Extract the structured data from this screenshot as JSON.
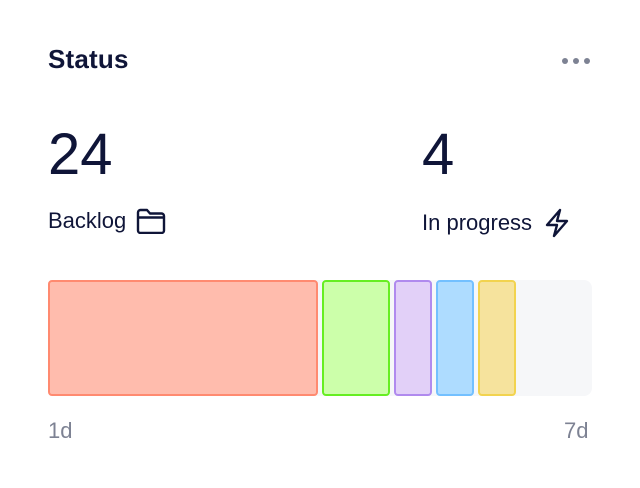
{
  "header": {
    "title": "Status",
    "menu_icon": "more-horizontal-icon"
  },
  "stats": {
    "backlog": {
      "value": "24",
      "label": "Backlog",
      "icon": "folder-icon"
    },
    "in_progress": {
      "value": "4",
      "label": "In progress",
      "icon": "lightning-icon"
    }
  },
  "bar": {
    "segments": [
      {
        "fill": "#ffbcad",
        "stroke": "#ff8a70"
      },
      {
        "fill": "#ccffaa",
        "stroke": "#66ee22"
      },
      {
        "fill": "#e2d0f8",
        "stroke": "#b08aee"
      },
      {
        "fill": "#aedcff",
        "stroke": "#73c0ff"
      },
      {
        "fill": "#f6e39d",
        "stroke": "#f2d34f"
      }
    ],
    "track_color": "#f6f7f9",
    "start_label": "1d",
    "end_label": "7d"
  }
}
